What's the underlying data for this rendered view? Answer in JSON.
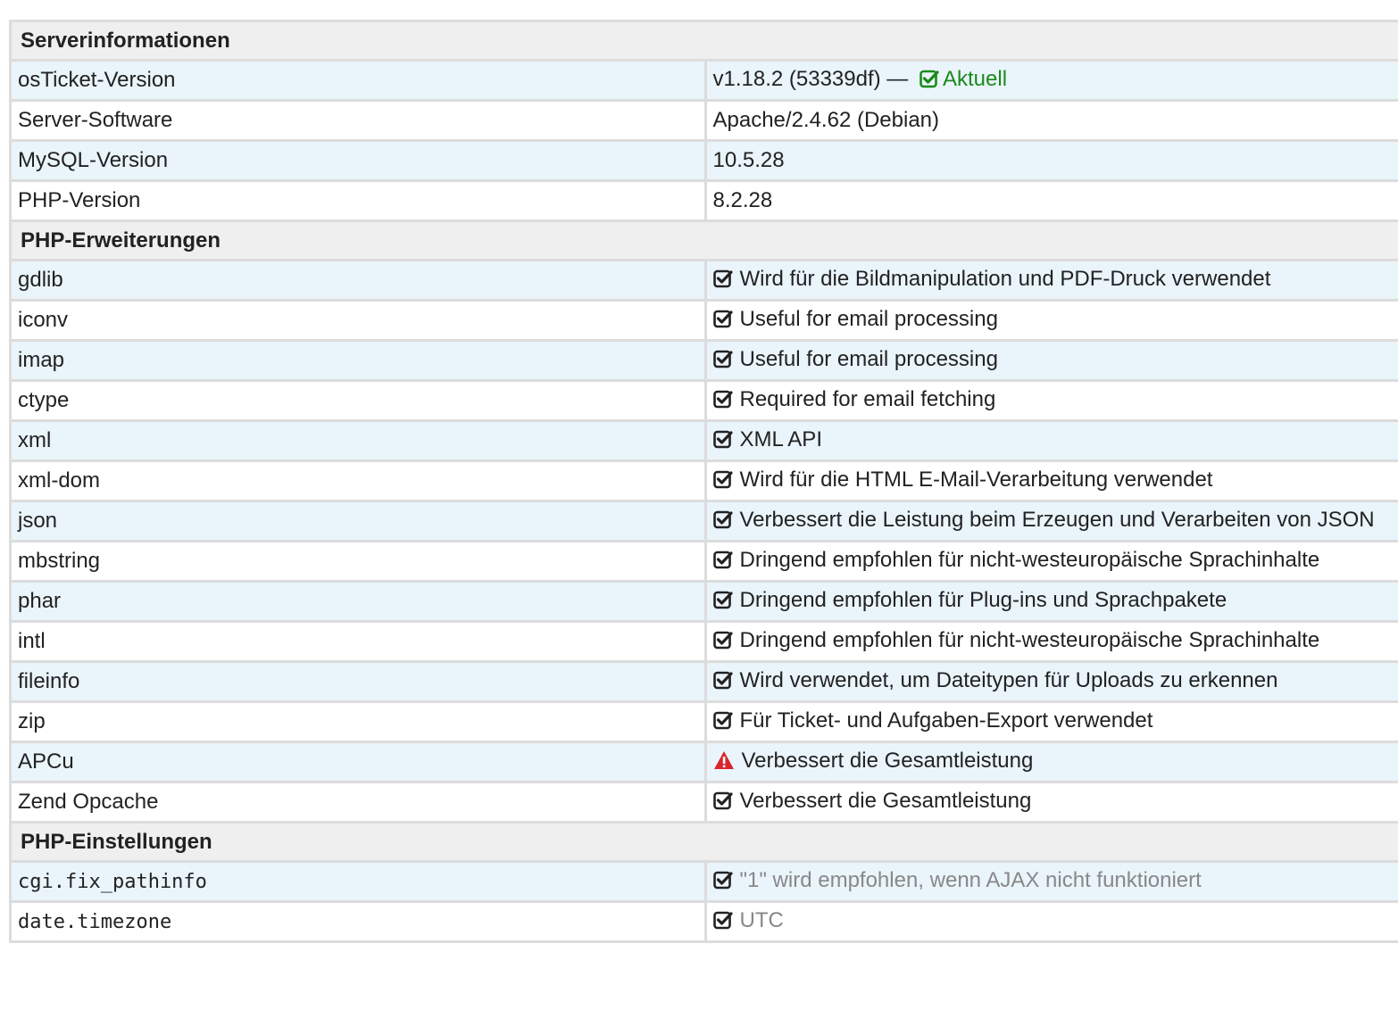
{
  "sections": {
    "server": {
      "title": "Serverinformationen",
      "rows": [
        {
          "key": "osTicket-Version",
          "value": "v1.18.2 (53339df) —",
          "status_label": "Aktuell"
        },
        {
          "key": "Server-Software",
          "value": "Apache/2.4.62 (Debian)"
        },
        {
          "key": "MySQL-Version",
          "value": "10.5.28"
        },
        {
          "key": "PHP-Version",
          "value": "8.2.28"
        }
      ]
    },
    "extensions": {
      "title": "PHP-Erweiterungen",
      "rows": [
        {
          "key": "gdlib",
          "icon": "check-square-icon",
          "value": "Wird für die Bildmanipulation und PDF-Druck verwendet"
        },
        {
          "key": "iconv",
          "icon": "check-square-icon",
          "value": "Useful for email processing"
        },
        {
          "key": "imap",
          "icon": "check-square-icon",
          "value": "Useful for email processing"
        },
        {
          "key": "ctype",
          "icon": "check-square-icon",
          "value": "Required for email fetching"
        },
        {
          "key": "xml",
          "icon": "check-square-icon",
          "value": "XML API"
        },
        {
          "key": "xml-dom",
          "icon": "check-square-icon",
          "value": "Wird für die HTML E-Mail-Verarbeitung verwendet"
        },
        {
          "key": "json",
          "icon": "check-square-icon",
          "value": "Verbessert die Leistung beim Erzeugen und Verarbeiten von JSON"
        },
        {
          "key": "mbstring",
          "icon": "check-square-icon",
          "value": "Dringend empfohlen für nicht-westeuropäische Sprachinhalte"
        },
        {
          "key": "phar",
          "icon": "check-square-icon",
          "value": "Dringend empfohlen für Plug-ins und Sprachpakete"
        },
        {
          "key": "intl",
          "icon": "check-square-icon",
          "value": "Dringend empfohlen für nicht-westeuropäische Sprachinhalte"
        },
        {
          "key": "fileinfo",
          "icon": "check-square-icon",
          "value": "Wird verwendet, um Dateitypen für Uploads zu erkennen"
        },
        {
          "key": "zip",
          "icon": "check-square-icon",
          "value": "Für Ticket- und Aufgaben-Export verwendet"
        },
        {
          "key": "APCu",
          "icon": "warning-icon",
          "value": "Verbessert die Gesamtleistung"
        },
        {
          "key": "Zend Opcache",
          "icon": "check-square-icon",
          "value": "Verbessert die Gesamtleistung"
        }
      ]
    },
    "settings": {
      "title": "PHP-Einstellungen",
      "rows": [
        {
          "key": "cgi.fix_pathinfo",
          "icon": "check-square-icon",
          "value": "\"1\" wird empfohlen, wenn AJAX nicht funktioniert"
        },
        {
          "key": "date.timezone",
          "icon": "check-square-icon",
          "value": "UTC"
        }
      ]
    }
  },
  "colors": {
    "header_bg": "#efefef",
    "alt_row_bg": "#eaf4fb",
    "ok_green": "#1a8a1a",
    "warning_red": "#d9262c",
    "muted_text": "#888888"
  }
}
